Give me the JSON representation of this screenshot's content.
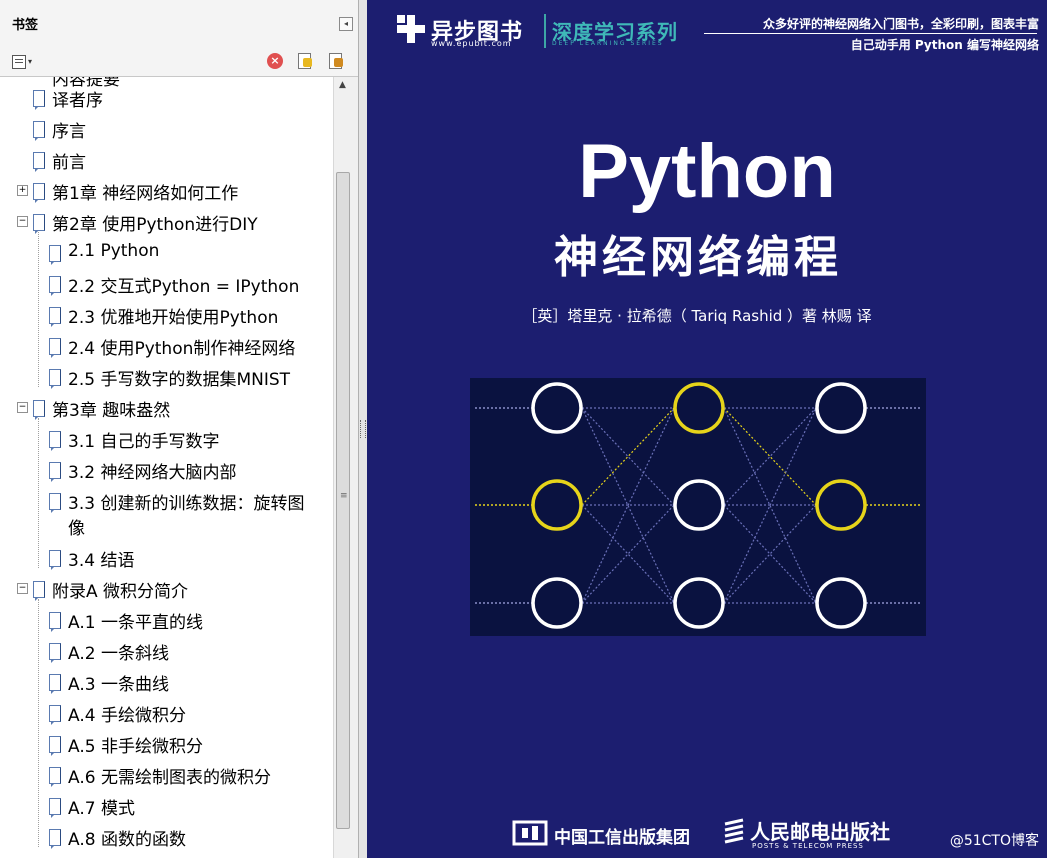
{
  "panel": {
    "title": "书签",
    "collapse_glyph": "◂",
    "toolbar": {
      "options_icon": "bookmark-options-icon",
      "delete_icon": "delete-bookmark-icon",
      "new_icon": "new-bookmark-icon",
      "goto_icon": "expand-bookmark-icon",
      "delete_glyph": "×"
    },
    "partial_item": "内容提要",
    "items": [
      {
        "label": "译者序",
        "level": 0,
        "expander": ""
      },
      {
        "label": "序言",
        "level": 0,
        "expander": ""
      },
      {
        "label": "前言",
        "level": 0,
        "expander": ""
      },
      {
        "label": "第1章 神经网络如何工作",
        "level": 0,
        "expander": "+"
      },
      {
        "label": "第2章 使用Python进行DIY",
        "level": 0,
        "expander": "−"
      },
      {
        "label": "2.1 Python",
        "level": 1,
        "expander": ""
      },
      {
        "label": "2.2 交互式Python = IPython",
        "level": 1,
        "expander": ""
      },
      {
        "label": "2.3 优雅地开始使用Python",
        "level": 1,
        "expander": ""
      },
      {
        "label": "2.4 使用Python制作神经网络",
        "level": 1,
        "expander": ""
      },
      {
        "label": "2.5 手写数字的数据集MNIST",
        "level": 1,
        "expander": ""
      },
      {
        "label": "第3章 趣味盎然",
        "level": 0,
        "expander": "−"
      },
      {
        "label": "3.1 自己的手写数字",
        "level": 1,
        "expander": ""
      },
      {
        "label": "3.2 神经网络大脑内部",
        "level": 1,
        "expander": ""
      },
      {
        "label": "3.3 创建新的训练数据：旋转图",
        "label2": "像",
        "level": 1,
        "expander": ""
      },
      {
        "label": "3.4 结语",
        "level": 1,
        "expander": ""
      },
      {
        "label": "附录A 微积分简介",
        "level": 0,
        "expander": "−"
      },
      {
        "label": "A.1 一条平直的线",
        "level": 1,
        "expander": ""
      },
      {
        "label": "A.2 一条斜线",
        "level": 1,
        "expander": ""
      },
      {
        "label": "A.3 一条曲线",
        "level": 1,
        "expander": ""
      },
      {
        "label": "A.4 手绘微积分",
        "level": 1,
        "expander": ""
      },
      {
        "label": "A.5 非手绘微积分",
        "level": 1,
        "expander": ""
      },
      {
        "label": "A.6 无需绘制图表的微积分",
        "level": 1,
        "expander": ""
      },
      {
        "label": "A.7 模式",
        "level": 1,
        "expander": ""
      },
      {
        "label": "A.8 函数的函数",
        "level": 1,
        "expander": ""
      }
    ],
    "scroll_up_glyph": "▲",
    "scroll_grip_glyph": "≡"
  },
  "cover": {
    "publisher_name": "异步图书",
    "publisher_url": "www.epubit.com",
    "series_name": "深度学习系列",
    "series_en": "DEEP LEARNING SERIES",
    "tagline1": "众多好评的神经网络入门图书，全彩印刷，图表丰富",
    "tagline2": "自己动手用 Python 编写神经网络",
    "title": "Python",
    "subtitle": "神经网络编程",
    "authors": "［英］塔里克 · 拉希德（ Tariq Rashid ）著   林赐 译",
    "publisher1": "中国工信出版集团",
    "publisher2": "人民邮电出版社",
    "publisher2_en": "POSTS & TELECOM PRESS",
    "watermark": "@51CTO博客",
    "colors": {
      "background": "#1c1e70",
      "highlight": "#e6d41a",
      "node": "#ffffff",
      "teal": "#3fb8b8"
    },
    "network": {
      "layers": 3,
      "nodes_per_layer": 3,
      "highlighted_nodes": [
        "input-2",
        "hidden-1",
        "output-2"
      ]
    }
  }
}
